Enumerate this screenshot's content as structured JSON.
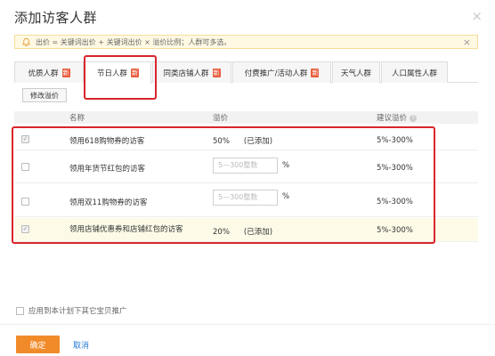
{
  "dialog": {
    "title": "添加访客人群",
    "close_glyph": "×"
  },
  "notice": {
    "text": "出价 = 关键词出价 + 关键词出价 × 溢价比例；人群可多选。",
    "close_glyph": "×"
  },
  "tabs": [
    {
      "label": "优质人群",
      "badge": "新"
    },
    {
      "label": "节日人群",
      "badge": "新"
    },
    {
      "label": "同类店铺人群",
      "badge": "新"
    },
    {
      "label": "付费推广/活动人群",
      "badge": "新"
    },
    {
      "label": "天气人群",
      "badge": ""
    },
    {
      "label": "人口属性人群",
      "badge": ""
    }
  ],
  "toolbar": {
    "edit_premium_label": "修改溢价"
  },
  "table": {
    "headers": {
      "name": "名称",
      "premium": "溢价",
      "suggest": "建议溢价"
    },
    "rows": [
      {
        "checked": true,
        "name": "领用618购物券的访客",
        "premium": "50%",
        "status": "(已添加)",
        "suggest": "5%-300%"
      },
      {
        "checked": false,
        "name": "领用年货节红包的访客",
        "placeholder": "5—300整数",
        "pct": "%",
        "suggest": "5%-300%"
      },
      {
        "checked": false,
        "name": "领用双11购物券的访客",
        "placeholder": "5—300整数",
        "pct": "%",
        "suggest": "5%-300%"
      },
      {
        "checked": true,
        "name": "领用店铺优惠券和店铺红包的访客",
        "premium": "20%",
        "status": "(已添加)",
        "suggest": "5%-300%"
      }
    ]
  },
  "apply_all_label": "应用到本计划下其它宝贝推广",
  "footer": {
    "ok_label": "确定",
    "cancel_label": "取消"
  },
  "colors": {
    "accent": "#f18b2a",
    "badge": "#e85d3e",
    "highlight": "#d9252c",
    "link": "#2a7ad6"
  }
}
